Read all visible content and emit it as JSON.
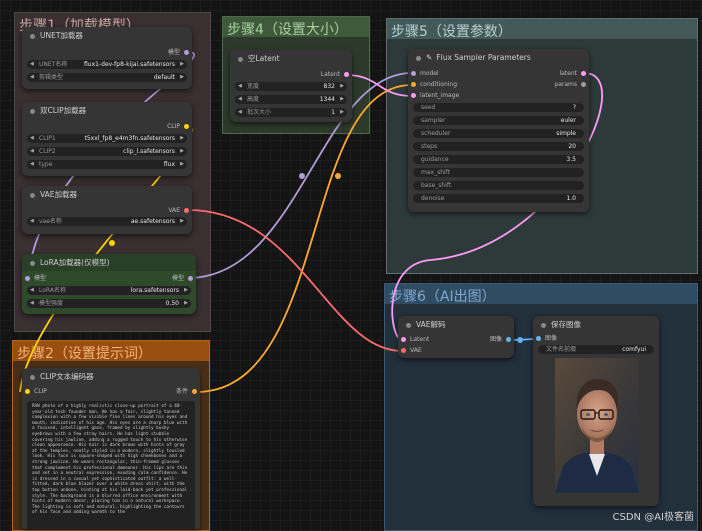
{
  "groups": {
    "g1": "步骤1（加载模型）",
    "g2": "步骤2（设置提示词）",
    "g4": "步骤4（设置大小）",
    "g5": "步骤5（设置参数）",
    "g6": "步骤6（AI出图）"
  },
  "unet": {
    "title": "UNET加载器",
    "output": "模型",
    "unet_name_label": "UNET名称",
    "unet_name_value": "flux1-dev-fp8-kijai.safetensors",
    "weight_label": "剪辑类型",
    "weight_value": "default"
  },
  "dualclip": {
    "title": "双CLIP加载器",
    "output": "CLIP",
    "clip1_label": "CLIP1",
    "clip1_value": "t5xxl_fp8_e4m3fn.safetensors",
    "clip2_label": "CLIP2",
    "clip2_value": "clip_l.safetensors",
    "type_label": "type",
    "type_value": "flux"
  },
  "vae": {
    "title": "VAE加载器",
    "output": "VAE",
    "name_label": "vae名称",
    "name_value": "ae.safetensors"
  },
  "lora": {
    "title": "LoRA加载器(仅模型)",
    "input": "模型",
    "output": "模型",
    "name_label": "LoRA名称",
    "name_value": "lora.safetensors",
    "strength_label": "模型强度",
    "strength_value": "0.50"
  },
  "clip_text": {
    "title": "CLIP文本编码器",
    "input": "CLIP",
    "output": "条件",
    "prompt": "RAW photo of a highly realistic close-up portrait of a 40-year-old tech founder man. He has a fair, slightly tanned complexion with a few visible fine lines around his eyes and mouth, indicative of his age. His eyes are a sharp blue with a focused, intelligent gaze, framed by slightly bushy eyebrows with a few stray hairs. He has light stubble covering his jawline, adding a rugged touch to his otherwise clean appearance. His hair is dark brown with hints of gray at the temples, neatly styled in a modern, slightly tousled look. His face is square-shaped with high cheekbones and a strong jawline. He wears rectangular, thin-framed glasses that complement his professional demeanor. His lips are thin and set in a neutral expression, exuding calm confidence. He is dressed in a casual yet sophisticated outfit: a well-fitted, dark blue blazer over a white dress shirt, with the top button undone, hinting at his laid-back yet professional style. The background is a blurred office environment with hints of modern decor, placing him in a natural workspace. The lighting is soft and natural, highlighting the contours of his face and adding warmth to the"
  },
  "empty_latent": {
    "title": "空Latent",
    "output": "Latent",
    "width_label": "宽度",
    "width_value": "832",
    "height_label": "高度",
    "height_value": "1344",
    "batch_label": "批次大小",
    "batch_value": "1"
  },
  "sampler": {
    "title": "Flux Sampler Parameters",
    "in_model": "model",
    "in_conditioning": "conditioning",
    "in_latent": "latent_image",
    "out_latent": "latent",
    "out_params": "params",
    "fields": [
      {
        "label": "seed",
        "value": "?"
      },
      {
        "label": "sampler",
        "value": "euler"
      },
      {
        "label": "scheduler",
        "value": "simple"
      },
      {
        "label": "steps",
        "value": "20"
      },
      {
        "label": "guidance",
        "value": "3.5"
      },
      {
        "label": "max_shift",
        "value": ""
      },
      {
        "label": "base_shift",
        "value": ""
      },
      {
        "label": "denoise",
        "value": "1.0"
      }
    ]
  },
  "vae_decode": {
    "title": "VAE解码",
    "in_latent": "Latent",
    "in_vae": "VAE",
    "output": "图像"
  },
  "save_image": {
    "title": "保存图像",
    "input": "图像",
    "prefix_label": "文件名前缀",
    "prefix_value": "comfyui"
  },
  "watermark": "CSDN @AI极客菌",
  "colors": {
    "model_link": "#b39ddb",
    "clip_link": "#ffd500",
    "cond_link": "#ffa931",
    "latent_link": "#ff9cf9",
    "vae_link": "#ff6e6e",
    "image_link": "#64b5f6"
  }
}
